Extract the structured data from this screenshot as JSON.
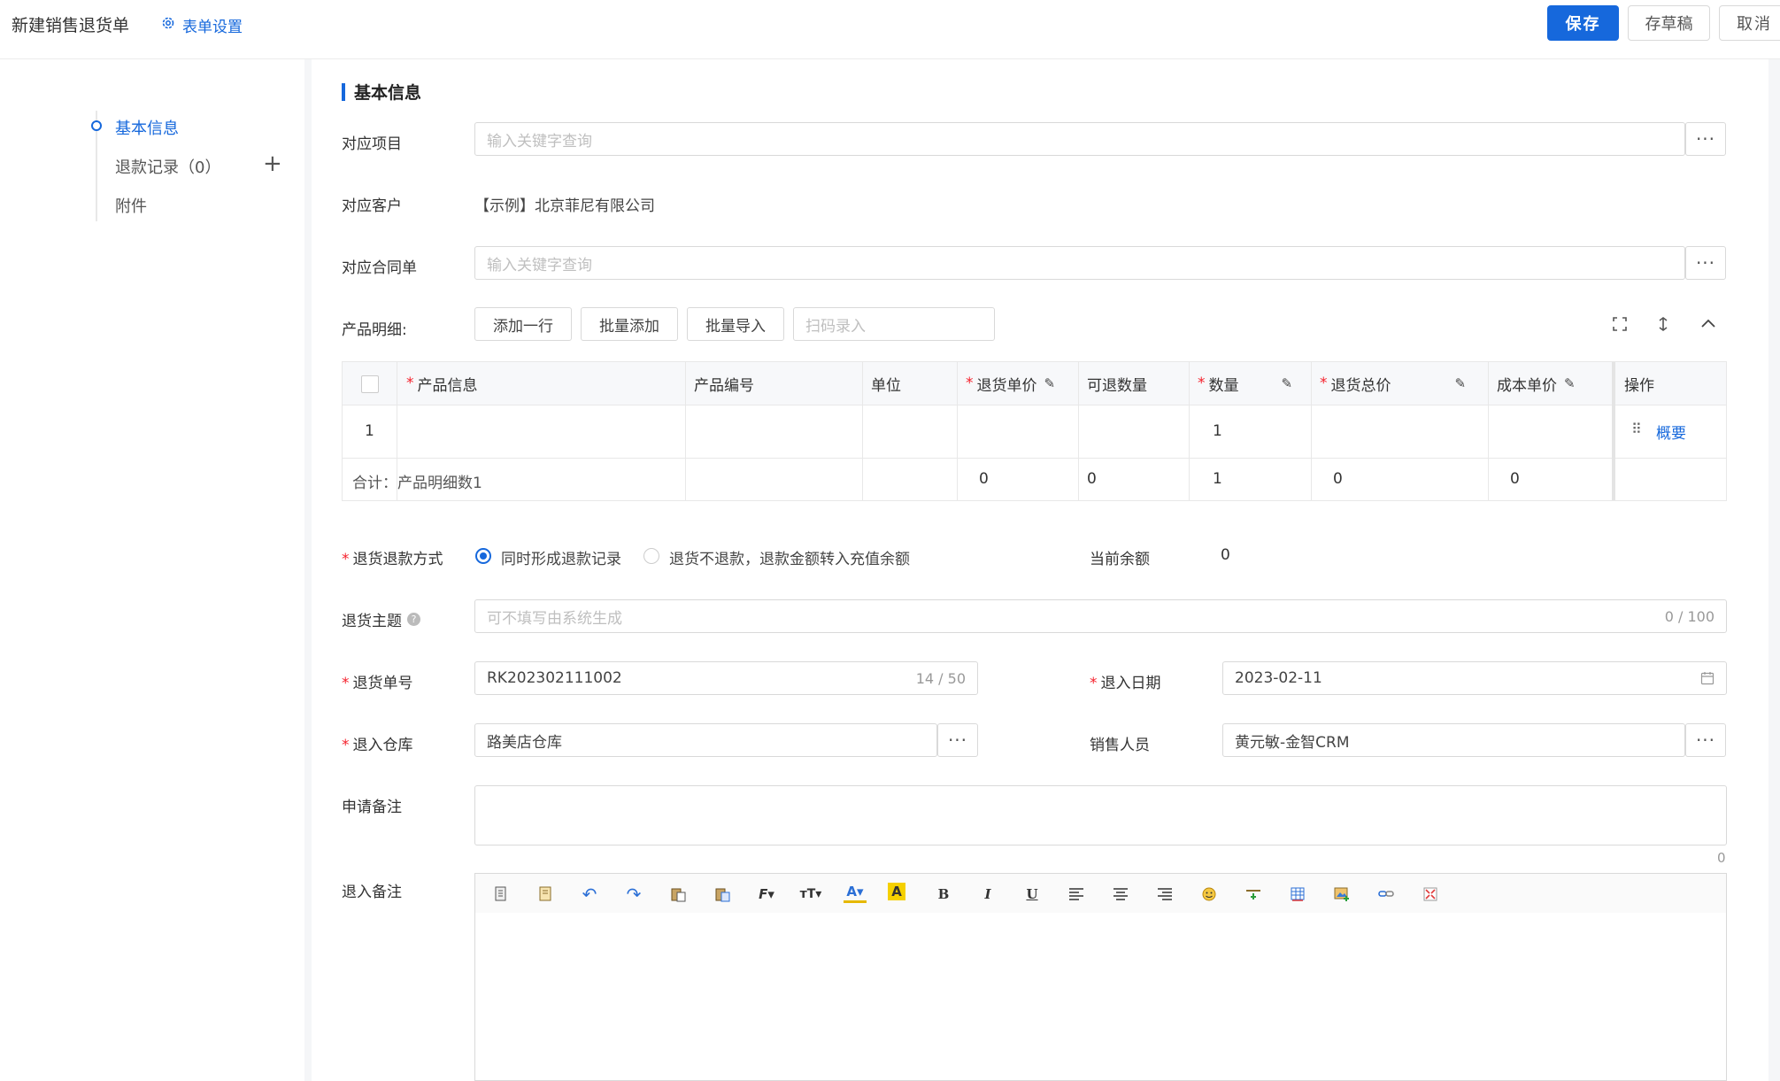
{
  "header": {
    "title": "新建销售退货单",
    "form_settings": "表单设置",
    "save": "保存",
    "draft": "存草稿",
    "cancel": "取消"
  },
  "sidebar": {
    "items": [
      {
        "label": "基本信息",
        "active": true
      },
      {
        "label": "退款记录（0）",
        "active": false
      },
      {
        "label": "附件",
        "active": false
      }
    ],
    "add": "+"
  },
  "section": {
    "title": "基本信息"
  },
  "form": {
    "project": {
      "label": "对应项目",
      "placeholder": "输入关键字查询",
      "more": "···"
    },
    "customer": {
      "label": "对应客户",
      "value": "【示例】北京菲尼有限公司"
    },
    "contract": {
      "label": "对应合同单",
      "placeholder": "输入关键字查询",
      "more": "···"
    },
    "products": {
      "label": "产品明细:",
      "add_row": "添加一行",
      "batch_add": "批量添加",
      "batch_import": "批量导入",
      "scan_placeholder": "扫码录入"
    },
    "refund_method": {
      "label": "退货退款方式",
      "option1": "同时形成退款记录",
      "option2": "退货不退款，退款金额转入充值余额",
      "balance_label": "当前余额",
      "balance_value": "0"
    },
    "subject": {
      "label": "退货主题",
      "placeholder": "可不填写由系统生成",
      "counter": "0 / 100"
    },
    "order_no": {
      "label": "退货单号",
      "value": "RK202302111002",
      "counter": "14 / 50"
    },
    "date": {
      "label": "退入日期",
      "value": "2023-02-11"
    },
    "warehouse": {
      "label": "退入仓库",
      "value": "路美店仓库",
      "more": "···"
    },
    "salesperson": {
      "label": "销售人员",
      "value": "黄元敏-金智CRM",
      "more": "···"
    },
    "apply_remark": {
      "label": "申请备注",
      "counter": "0"
    },
    "in_remark": {
      "label": "退入备注"
    }
  },
  "table": {
    "headers": {
      "product_info": "产品信息",
      "product_code": "产品编号",
      "unit": "单位",
      "return_price": "退货单价",
      "returnable_qty": "可退数量",
      "qty": "数量",
      "return_total": "退货总价",
      "cost_price": "成本单价",
      "action": "操作"
    },
    "row": {
      "index": "1",
      "qty": "1",
      "action": "概要"
    },
    "summary": {
      "label": "合计：产品明细数1",
      "return_price": "0",
      "returnable_qty": "0",
      "qty": "1",
      "return_total": "0",
      "cost_price": "0"
    }
  },
  "colors": {
    "primary": "#1668dc",
    "required": "#f5222d"
  }
}
